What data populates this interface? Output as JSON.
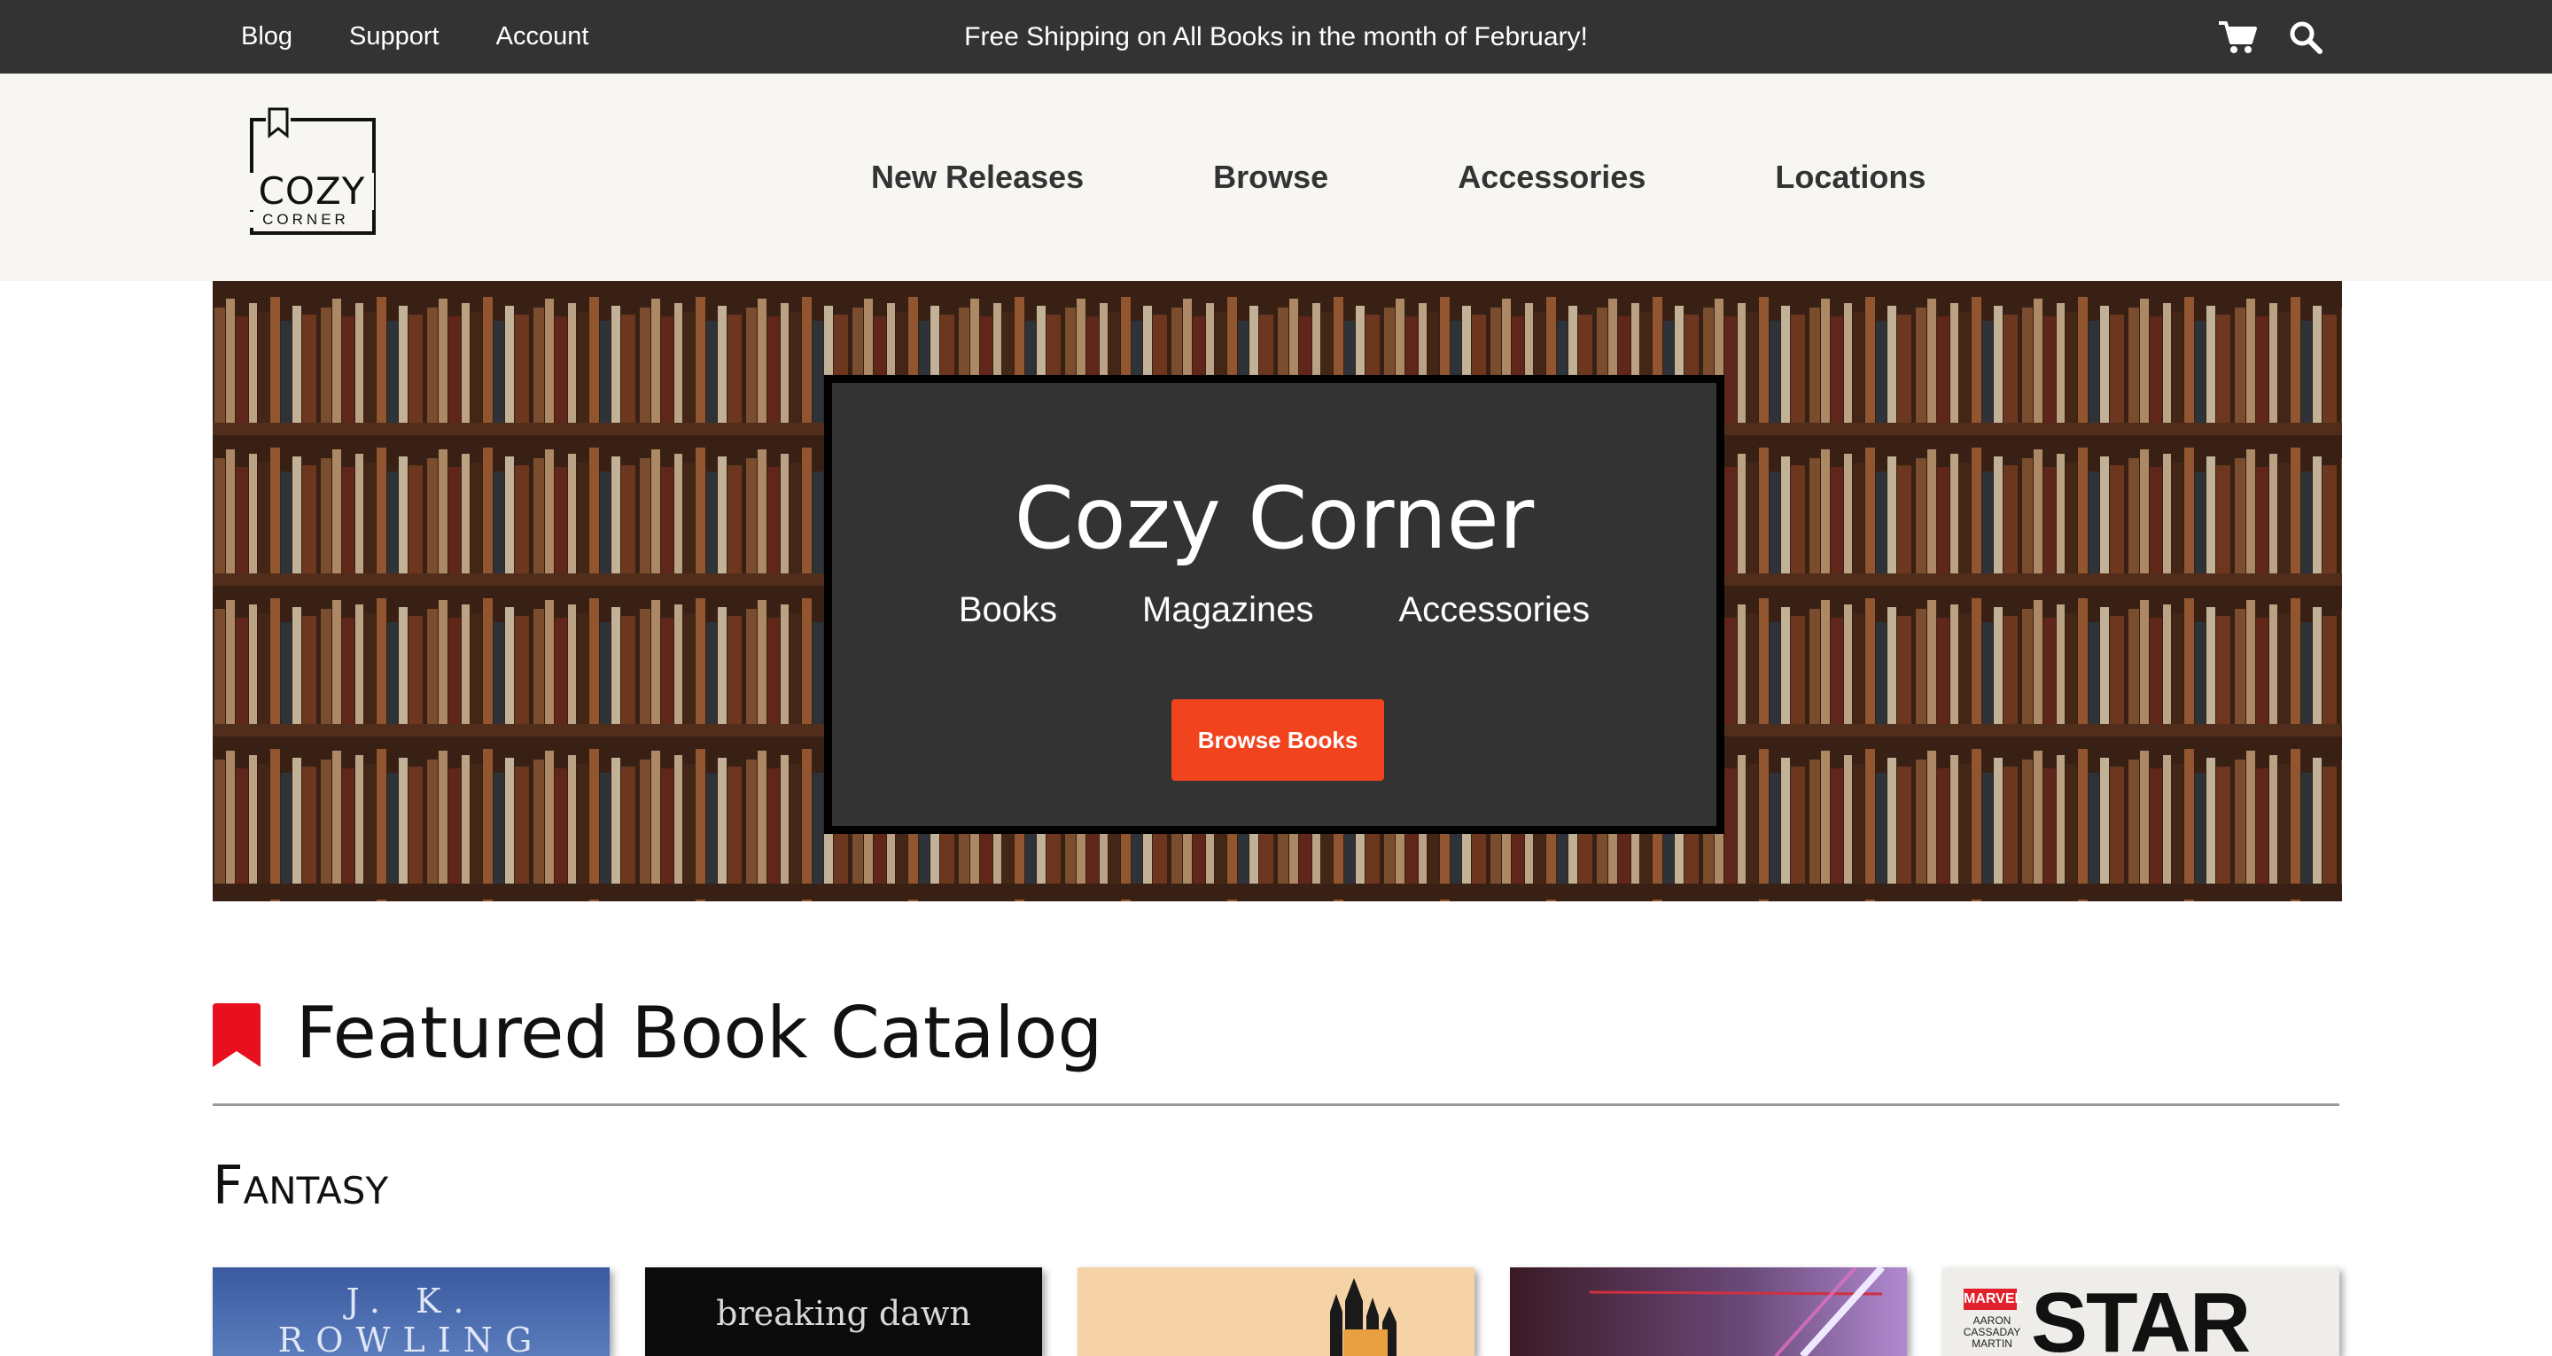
{
  "topbar": {
    "links": [
      "Blog",
      "Support",
      "Account"
    ],
    "promo": "Free Shipping on All Books in the month of February!",
    "icons": [
      "cart-icon",
      "search-icon"
    ]
  },
  "logo": {
    "line1": "COZY",
    "line2": "CORNER"
  },
  "nav": {
    "items": [
      "New Releases",
      "Browse",
      "Accessories",
      "Locations"
    ]
  },
  "hero": {
    "title": "Cozy Corner",
    "links": [
      "Books",
      "Magazines",
      "Accessories"
    ],
    "button": "Browse Books"
  },
  "featured": {
    "title": "Featured Book Catalog",
    "genre": "Fantasy"
  },
  "books": [
    {
      "cover_text": "J. K. ROWLING"
    },
    {
      "cover_text": "breaking dawn"
    },
    {
      "cover_text": ""
    },
    {
      "cover_text": ""
    },
    {
      "cover_text": "STAR",
      "publisher": "MARVEL",
      "authors": "AARON CASSADAY MARTIN"
    }
  ],
  "colors": {
    "topbar": "#333333",
    "nav": "#f8f6f2",
    "accent": "#f0431e",
    "bookmark": "#e8101e"
  }
}
